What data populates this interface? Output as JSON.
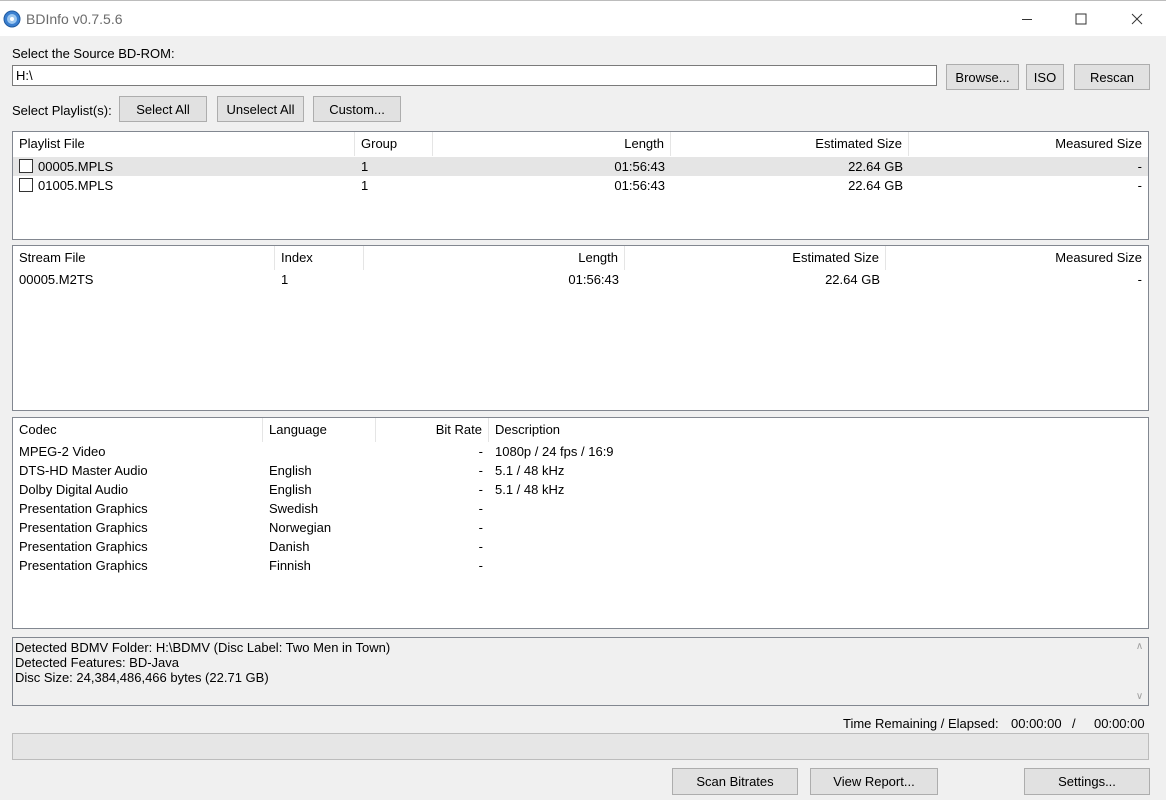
{
  "window": {
    "title": "BDInfo v0.7.5.6"
  },
  "source": {
    "label": "Select the Source BD-ROM:",
    "path": "H:\\",
    "browse_label": "Browse...",
    "iso_label": "ISO",
    "rescan_label": "Rescan"
  },
  "playlist_select": {
    "label": "Select Playlist(s):",
    "select_all_label": "Select All",
    "unselect_all_label": "Unselect All",
    "custom_label": "Custom..."
  },
  "playlists": {
    "headers": [
      "Playlist File",
      "Group",
      "Length",
      "Estimated Size",
      "Measured Size"
    ],
    "rows": [
      {
        "file": "00005.MPLS",
        "group": "1",
        "length": "01:56:43",
        "estimated_size": "22.64 GB",
        "measured_size": "-",
        "checked": false
      },
      {
        "file": "01005.MPLS",
        "group": "1",
        "length": "01:56:43",
        "estimated_size": "22.64 GB",
        "measured_size": "-",
        "checked": false
      }
    ]
  },
  "streams": {
    "headers": [
      "Stream File",
      "Index",
      "Length",
      "Estimated Size",
      "Measured Size"
    ],
    "rows": [
      {
        "file": "00005.M2TS",
        "index": "1",
        "length": "01:56:43",
        "estimated_size": "22.64 GB",
        "measured_size": "-"
      }
    ]
  },
  "codecs": {
    "headers": [
      "Codec",
      "Language",
      "Bit Rate",
      "Description"
    ],
    "rows": [
      {
        "codec": "MPEG-2 Video",
        "language": "",
        "bitrate": "-",
        "description": "1080p / 24 fps / 16:9"
      },
      {
        "codec": "DTS-HD Master Audio",
        "language": "English",
        "bitrate": "-",
        "description": "5.1 / 48 kHz"
      },
      {
        "codec": "Dolby Digital Audio",
        "language": "English",
        "bitrate": "-",
        "description": "5.1 / 48 kHz"
      },
      {
        "codec": "Presentation Graphics",
        "language": "Swedish",
        "bitrate": "-",
        "description": ""
      },
      {
        "codec": "Presentation Graphics",
        "language": "Norwegian",
        "bitrate": "-",
        "description": ""
      },
      {
        "codec": "Presentation Graphics",
        "language": "Danish",
        "bitrate": "-",
        "description": ""
      },
      {
        "codec": "Presentation Graphics",
        "language": "Finnish",
        "bitrate": "-",
        "description": ""
      }
    ]
  },
  "info": {
    "lines": [
      "Detected BDMV Folder: H:\\BDMV (Disc Label: Two Men in Town)",
      "Detected Features: BD-Java",
      "Disc Size: 24,384,486,466 bytes (22.71 GB)"
    ]
  },
  "status": {
    "time_label": "Time Remaining / Elapsed:",
    "remaining": "00:00:00",
    "separator": "/",
    "elapsed": "00:00:00",
    "progress": 0
  },
  "actions": {
    "scan_bitrates_label": "Scan Bitrates",
    "view_report_label": "View Report...",
    "settings_label": "Settings..."
  },
  "colors": {
    "window_bg": "#f0f0f0",
    "selected_row": "#e5e5e5",
    "button_bg": "#e1e1e1",
    "progress_fill": "#06b025"
  },
  "icons": [
    "disc-icon",
    "minimize-icon",
    "maximize-icon",
    "close-icon",
    "checkbox",
    "scroll-up-icon",
    "scroll-down-icon"
  ]
}
